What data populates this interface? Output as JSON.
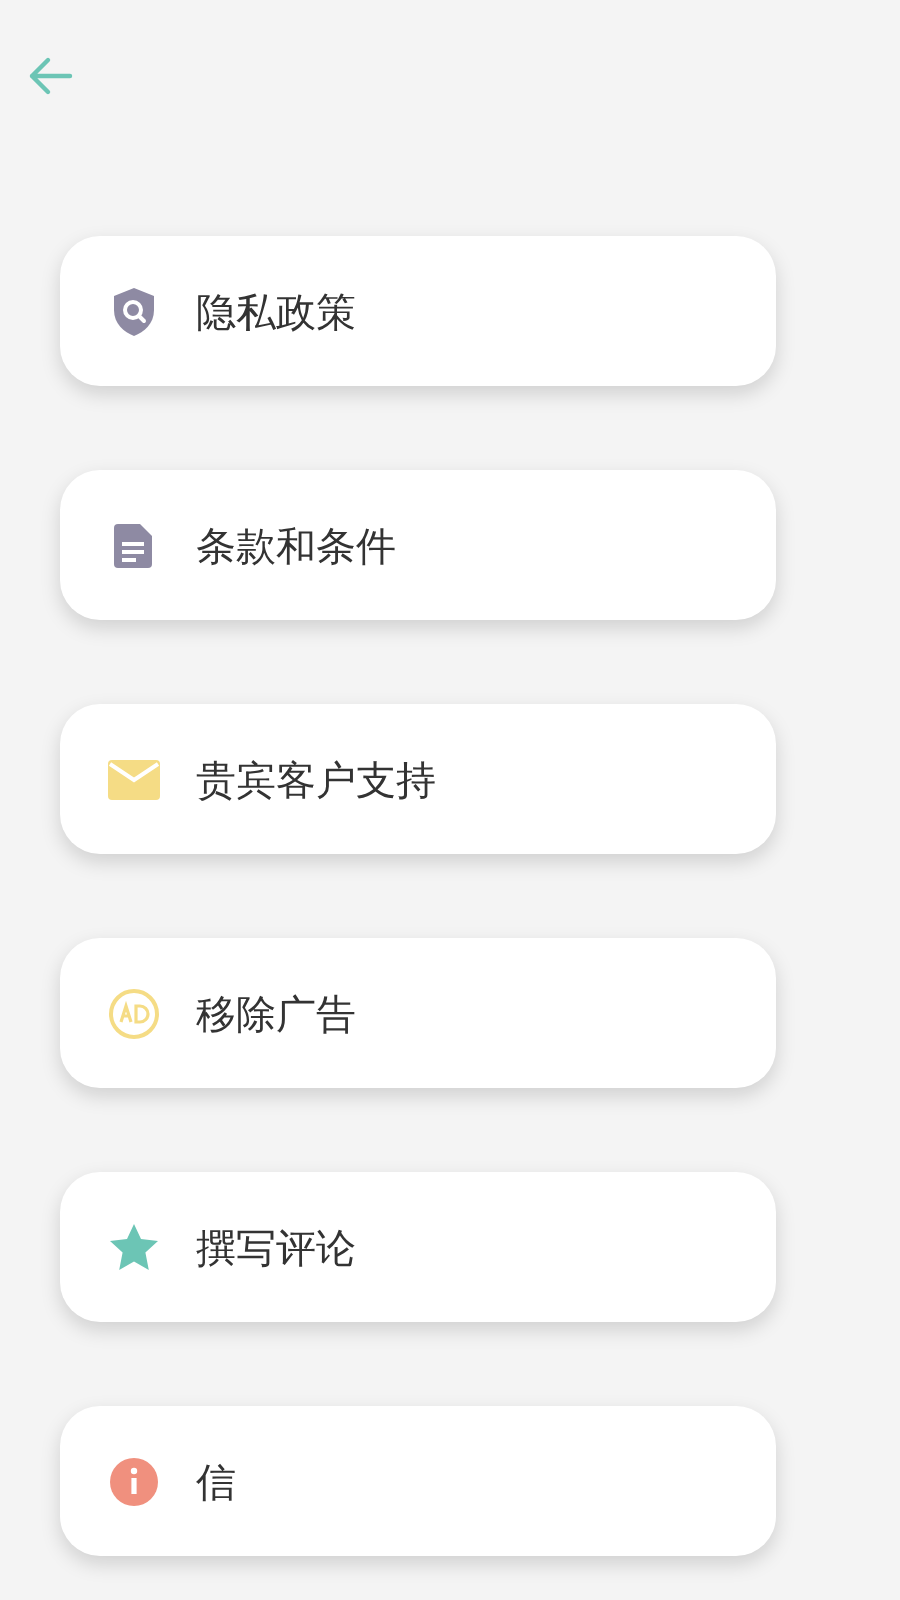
{
  "menu_items": [
    {
      "kind": "privacy",
      "label": "隐私政策"
    },
    {
      "kind": "terms",
      "label": "条款和条件"
    },
    {
      "kind": "support",
      "label": "贵宾客户支持"
    },
    {
      "kind": "ads",
      "label": "移除广告"
    },
    {
      "kind": "review",
      "label": "撰写评论"
    },
    {
      "kind": "info",
      "label": "信"
    }
  ]
}
